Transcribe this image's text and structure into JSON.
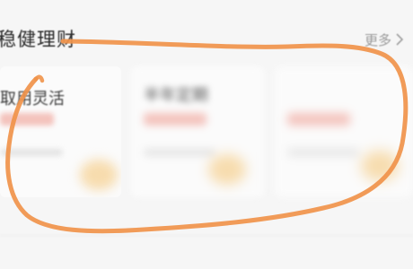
{
  "section": {
    "title": "稳健理财",
    "more_label": "更多",
    "more_icon": "chevron-right-icon"
  },
  "cards": [
    {
      "title": "取用灵活"
    },
    {
      "title": "半年定期"
    },
    {
      "title": ""
    }
  ],
  "overlay": {
    "icon": "scribble-annotation",
    "color": "#f0934a"
  }
}
